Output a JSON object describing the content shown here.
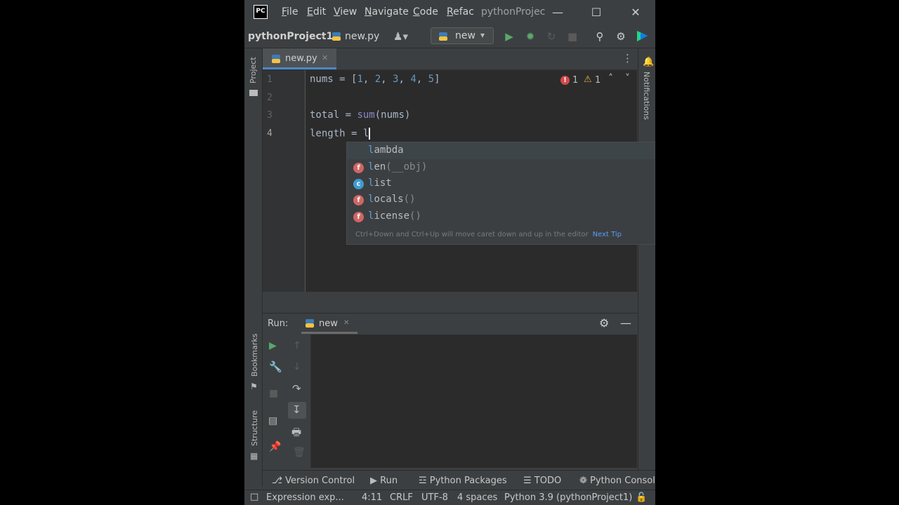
{
  "app": {
    "logo": "PC"
  },
  "menu": [
    {
      "label": "File",
      "u": "F",
      "rest": "ile"
    },
    {
      "label": "Edit",
      "u": "E",
      "rest": "dit"
    },
    {
      "label": "View",
      "u": "V",
      "rest": "iew"
    },
    {
      "label": "Navigate",
      "u": "N",
      "rest": "avigate"
    },
    {
      "label": "Code",
      "u": "C",
      "rest": "ode"
    },
    {
      "label": "Refac",
      "u": "R",
      "rest": "efac"
    }
  ],
  "window_title": "pythonProjec",
  "breadcrumb": {
    "project": "pythonProject1",
    "file": "new.py"
  },
  "run_config": "new",
  "left_stripe": {
    "project": "Project",
    "bookmarks": "Bookmarks",
    "structure": "Structure"
  },
  "right_stripe": {
    "notifications": "Notifications"
  },
  "editor_tab": {
    "label": "new.py"
  },
  "inspections": {
    "errors": "1",
    "warnings": "1"
  },
  "line_numbers": [
    "1",
    "2",
    "3",
    "4"
  ],
  "code": {
    "line1_var": "nums = [",
    "line1_nums": [
      "1",
      "2",
      "3",
      "4",
      "5"
    ],
    "line3_a": "total = ",
    "line3_fn": "sum",
    "line3_b": "(nums)",
    "line4": "length = l"
  },
  "completion": {
    "items": [
      {
        "prefix": "l",
        "rest": "ambda",
        "tail": "",
        "kind": ""
      },
      {
        "prefix": "l",
        "rest": "en",
        "tail": "(__obj)",
        "kind": "f"
      },
      {
        "prefix": "l",
        "rest": "ist",
        "tail": "",
        "kind": "c"
      },
      {
        "prefix": "l",
        "rest": "ocals",
        "tail": "()",
        "kind": "f"
      },
      {
        "prefix": "l",
        "rest": "icense",
        "tail": "()",
        "kind": "f"
      }
    ],
    "tip": "Ctrl+Down and Ctrl+Up will move caret down and up in the editor",
    "tip_link": "Next Tip"
  },
  "run_panel": {
    "title": "Run:",
    "tab": "new"
  },
  "bottom_tabs": [
    "Version Control",
    "Run",
    "Python Packages",
    "TODO",
    "Python Consol"
  ],
  "status": {
    "message": "Expression exp...",
    "position": "4:11",
    "line_sep": "CRLF",
    "encoding": "UTF-8",
    "indent": "4 spaces",
    "interpreter": "Python 3.9 (pythonProject1)"
  },
  "colors": {
    "accent": "#4a88c7",
    "run_green": "#59a869",
    "error_red": "#d26565",
    "class_blue": "#3f9bd3"
  }
}
